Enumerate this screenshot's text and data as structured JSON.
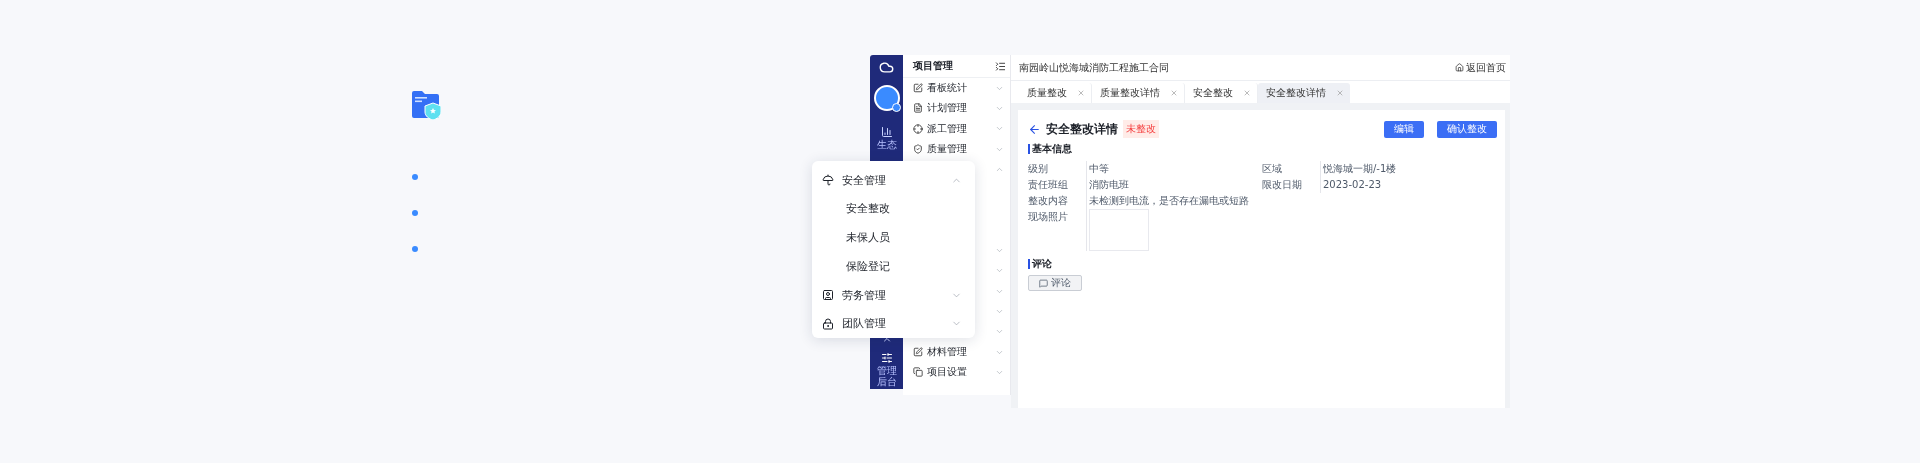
{
  "app": {
    "rail": {
      "items": [
        {
          "label": "生态"
        }
      ],
      "footer_label": "管理后台"
    },
    "nav": {
      "title": "项目管理",
      "items": [
        {
          "label": "看板统计",
          "expanded": false
        },
        {
          "label": "计划管理",
          "expanded": false
        },
        {
          "label": "派工管理",
          "expanded": false
        },
        {
          "label": "质量管理",
          "expanded": false
        },
        {
          "expanded": true
        },
        {
          "expanded": false
        },
        {
          "expanded": false
        },
        {
          "expanded": false
        },
        {
          "expanded": false
        },
        {
          "expanded": false
        },
        {
          "label": "材料管理",
          "expanded": false
        },
        {
          "label": "项目设置",
          "expanded": false
        }
      ]
    },
    "header": {
      "title": "南园岭山悦海城消防工程施工合同",
      "link": "返回首页"
    },
    "tabs": [
      {
        "label": "质量整改",
        "selected": false
      },
      {
        "label": "质量整改详情",
        "selected": false
      },
      {
        "label": "安全整改",
        "selected": false
      },
      {
        "label": "安全整改详情",
        "selected": true
      }
    ],
    "detail": {
      "title": "安全整改详情",
      "status": "未整改",
      "actions": [
        {
          "label": "编辑"
        },
        {
          "label": "确认整改"
        }
      ],
      "basic": {
        "title": "基本信息",
        "fields": [
          {
            "kind": "pair",
            "label": "级别",
            "value": "中等"
          },
          {
            "kind": "pair",
            "label": "区域",
            "value": "悦海城一期/-1楼"
          },
          {
            "kind": "pair",
            "label": "责任班组",
            "value": "消防电班"
          },
          {
            "kind": "pair",
            "label": "限改日期",
            "value": "2023-02-23"
          },
          {
            "kind": "wide",
            "label": "整改内容",
            "value": "未检测到电流，是否存在漏电或短路"
          },
          {
            "kind": "photo",
            "label": "现场照片"
          }
        ]
      },
      "comments": {
        "title": "评论",
        "button": "评论"
      }
    }
  },
  "flyout": {
    "items": [
      {
        "label": "安全管理",
        "expanded": true,
        "children": [
          {
            "label": "安全整改"
          },
          {
            "label": "未保人员"
          },
          {
            "label": "保险登记"
          }
        ]
      },
      {
        "label": "劳务管理",
        "expanded": false
      },
      {
        "label": "团队管理",
        "expanded": false
      }
    ]
  }
}
